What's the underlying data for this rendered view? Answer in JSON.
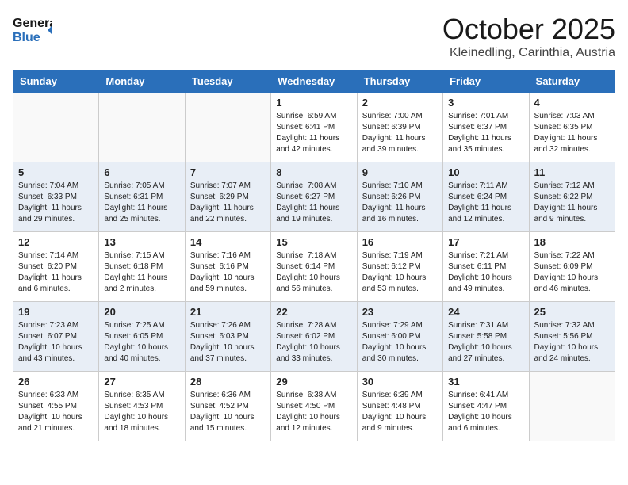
{
  "logo": {
    "line1": "General",
    "line2": "Blue"
  },
  "header": {
    "month": "October 2025",
    "location": "Kleinedling, Carinthia, Austria"
  },
  "weekdays": [
    "Sunday",
    "Monday",
    "Tuesday",
    "Wednesday",
    "Thursday",
    "Friday",
    "Saturday"
  ],
  "weeks": [
    [
      {
        "day": "",
        "info": ""
      },
      {
        "day": "",
        "info": ""
      },
      {
        "day": "",
        "info": ""
      },
      {
        "day": "1",
        "info": "Sunrise: 6:59 AM\nSunset: 6:41 PM\nDaylight: 11 hours\nand 42 minutes."
      },
      {
        "day": "2",
        "info": "Sunrise: 7:00 AM\nSunset: 6:39 PM\nDaylight: 11 hours\nand 39 minutes."
      },
      {
        "day": "3",
        "info": "Sunrise: 7:01 AM\nSunset: 6:37 PM\nDaylight: 11 hours\nand 35 minutes."
      },
      {
        "day": "4",
        "info": "Sunrise: 7:03 AM\nSunset: 6:35 PM\nDaylight: 11 hours\nand 32 minutes."
      }
    ],
    [
      {
        "day": "5",
        "info": "Sunrise: 7:04 AM\nSunset: 6:33 PM\nDaylight: 11 hours\nand 29 minutes."
      },
      {
        "day": "6",
        "info": "Sunrise: 7:05 AM\nSunset: 6:31 PM\nDaylight: 11 hours\nand 25 minutes."
      },
      {
        "day": "7",
        "info": "Sunrise: 7:07 AM\nSunset: 6:29 PM\nDaylight: 11 hours\nand 22 minutes."
      },
      {
        "day": "8",
        "info": "Sunrise: 7:08 AM\nSunset: 6:27 PM\nDaylight: 11 hours\nand 19 minutes."
      },
      {
        "day": "9",
        "info": "Sunrise: 7:10 AM\nSunset: 6:26 PM\nDaylight: 11 hours\nand 16 minutes."
      },
      {
        "day": "10",
        "info": "Sunrise: 7:11 AM\nSunset: 6:24 PM\nDaylight: 11 hours\nand 12 minutes."
      },
      {
        "day": "11",
        "info": "Sunrise: 7:12 AM\nSunset: 6:22 PM\nDaylight: 11 hours\nand 9 minutes."
      }
    ],
    [
      {
        "day": "12",
        "info": "Sunrise: 7:14 AM\nSunset: 6:20 PM\nDaylight: 11 hours\nand 6 minutes."
      },
      {
        "day": "13",
        "info": "Sunrise: 7:15 AM\nSunset: 6:18 PM\nDaylight: 11 hours\nand 2 minutes."
      },
      {
        "day": "14",
        "info": "Sunrise: 7:16 AM\nSunset: 6:16 PM\nDaylight: 10 hours\nand 59 minutes."
      },
      {
        "day": "15",
        "info": "Sunrise: 7:18 AM\nSunset: 6:14 PM\nDaylight: 10 hours\nand 56 minutes."
      },
      {
        "day": "16",
        "info": "Sunrise: 7:19 AM\nSunset: 6:12 PM\nDaylight: 10 hours\nand 53 minutes."
      },
      {
        "day": "17",
        "info": "Sunrise: 7:21 AM\nSunset: 6:11 PM\nDaylight: 10 hours\nand 49 minutes."
      },
      {
        "day": "18",
        "info": "Sunrise: 7:22 AM\nSunset: 6:09 PM\nDaylight: 10 hours\nand 46 minutes."
      }
    ],
    [
      {
        "day": "19",
        "info": "Sunrise: 7:23 AM\nSunset: 6:07 PM\nDaylight: 10 hours\nand 43 minutes."
      },
      {
        "day": "20",
        "info": "Sunrise: 7:25 AM\nSunset: 6:05 PM\nDaylight: 10 hours\nand 40 minutes."
      },
      {
        "day": "21",
        "info": "Sunrise: 7:26 AM\nSunset: 6:03 PM\nDaylight: 10 hours\nand 37 minutes."
      },
      {
        "day": "22",
        "info": "Sunrise: 7:28 AM\nSunset: 6:02 PM\nDaylight: 10 hours\nand 33 minutes."
      },
      {
        "day": "23",
        "info": "Sunrise: 7:29 AM\nSunset: 6:00 PM\nDaylight: 10 hours\nand 30 minutes."
      },
      {
        "day": "24",
        "info": "Sunrise: 7:31 AM\nSunset: 5:58 PM\nDaylight: 10 hours\nand 27 minutes."
      },
      {
        "day": "25",
        "info": "Sunrise: 7:32 AM\nSunset: 5:56 PM\nDaylight: 10 hours\nand 24 minutes."
      }
    ],
    [
      {
        "day": "26",
        "info": "Sunrise: 6:33 AM\nSunset: 4:55 PM\nDaylight: 10 hours\nand 21 minutes."
      },
      {
        "day": "27",
        "info": "Sunrise: 6:35 AM\nSunset: 4:53 PM\nDaylight: 10 hours\nand 18 minutes."
      },
      {
        "day": "28",
        "info": "Sunrise: 6:36 AM\nSunset: 4:52 PM\nDaylight: 10 hours\nand 15 minutes."
      },
      {
        "day": "29",
        "info": "Sunrise: 6:38 AM\nSunset: 4:50 PM\nDaylight: 10 hours\nand 12 minutes."
      },
      {
        "day": "30",
        "info": "Sunrise: 6:39 AM\nSunset: 4:48 PM\nDaylight: 10 hours\nand 9 minutes."
      },
      {
        "day": "31",
        "info": "Sunrise: 6:41 AM\nSunset: 4:47 PM\nDaylight: 10 hours\nand 6 minutes."
      },
      {
        "day": "",
        "info": ""
      }
    ]
  ]
}
